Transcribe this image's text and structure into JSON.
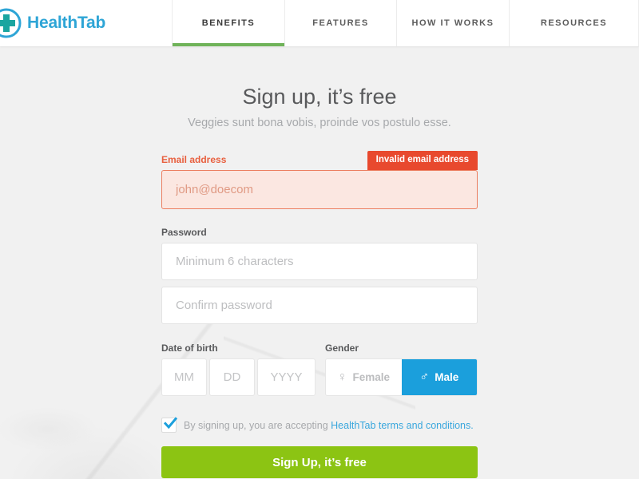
{
  "brand": {
    "name": "HealthTab",
    "logo_icon": "medical-cross-circle-icon",
    "color": "#2ea5d6"
  },
  "nav": {
    "items": [
      {
        "label": "BENEFITS",
        "active": true
      },
      {
        "label": "FEATURES",
        "active": false
      },
      {
        "label": "HOW IT WORKS",
        "active": false
      },
      {
        "label": "RESOURCES",
        "active": false
      }
    ],
    "active_underline_color": "#6fb359"
  },
  "main": {
    "title": "Sign up, it’s free",
    "subtitle": "Veggies sunt bona vobis, proinde vos postulo esse."
  },
  "form": {
    "email": {
      "label": "Email address",
      "value": "john@doecom",
      "error_badge": "Invalid email address",
      "error_color": "#e8492e",
      "field_bg": "#fbe7e1",
      "field_border": "#ec7f61"
    },
    "password": {
      "label": "Password",
      "placeholder": "Minimum 6 characters",
      "confirm_placeholder": "Confirm password"
    },
    "dob": {
      "label": "Date of birth",
      "month_placeholder": "MM",
      "day_placeholder": "DD",
      "year_placeholder": "YYYY"
    },
    "gender": {
      "label": "Gender",
      "female_label": "Female",
      "female_icon": "venus-symbol-icon",
      "female_glyph": "♀",
      "male_label": "Male",
      "male_icon": "mars-symbol-icon",
      "male_glyph": "♂",
      "selected": "Male",
      "selected_color": "#1b9fdc"
    },
    "terms": {
      "checked": true,
      "text": "By signing up, you are accepting ",
      "link_text": "HealthTab terms and conditions.",
      "link_color": "#3aa7dd",
      "check_color": "#1b9fdc"
    },
    "submit": {
      "label": "Sign Up, it’s free",
      "color": "#8cc413"
    }
  }
}
